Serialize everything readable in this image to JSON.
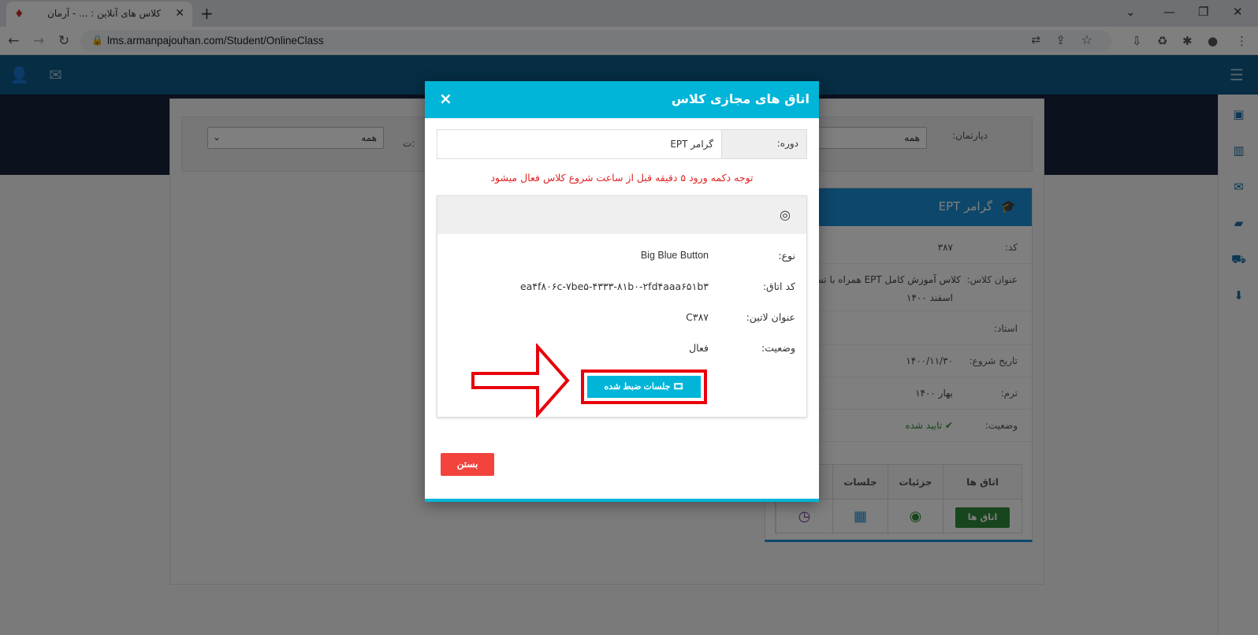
{
  "browser": {
    "tab_title": "کلاس های آنلاین : ... - آرمان",
    "url": "lms.armanpajouhan.com/Student/OnlineClass"
  },
  "filter": {
    "department_label": "دپارتمان:",
    "department_value": "همه",
    "second_value": "همه",
    "partial_label": "ت:"
  },
  "card": {
    "title": "گرامر EPT",
    "rows": [
      {
        "key": "کد:",
        "value": "۳۸۷"
      },
      {
        "key": "عنوان کلاس:",
        "value": "کلاس آموزش کامل EPT همراه با تس"
      },
      {
        "key": "",
        "value": "اسفند ۱۴۰۰"
      },
      {
        "key": "استاد:",
        "value": ""
      },
      {
        "key": "تاریخ شروع:",
        "value": "۱۴۰۰/۱۱/۳۰"
      },
      {
        "key": "ترم:",
        "value": "بهار ۱۴۰۰"
      },
      {
        "key": "وضعیت:",
        "value": "✔ تایید شده"
      }
    ],
    "table_headers": [
      "اتاق ها",
      "جزئیات",
      "جلسات",
      ""
    ],
    "rooms_button": "اتاق ها"
  },
  "modal": {
    "title": "اتاق های مجازی کلاس",
    "course_label": "دوره:",
    "course_value": "گرامر EPT",
    "notice": "توجه دکمه ورود ۵ دقیقه قبل از ساعت شروع کلاس فعال میشود",
    "details": [
      {
        "key": "نوع:",
        "value": "Big Blue Button"
      },
      {
        "key": "کد اتاق:",
        "value": "ea۴f۸۰۶c-۷be۵-۴۳۳۳-۸۱b۰-۲fd۴aaa۶۵۱b۳"
      },
      {
        "key": "عنوان لاتین:",
        "value": "C۳۸۷"
      },
      {
        "key": "وضعیت:",
        "value": "فعال"
      }
    ],
    "recordings_button": "جلسات ضبط شده",
    "close_button": "بستن"
  },
  "colors": {
    "header_blue": "#0d5b87",
    "modal_cyan": "#00b5d8",
    "danger_red": "#f2433d",
    "highlight_red": "#e8000b",
    "card_blue": "#1a8fd6",
    "green": "#2e8b3a"
  }
}
